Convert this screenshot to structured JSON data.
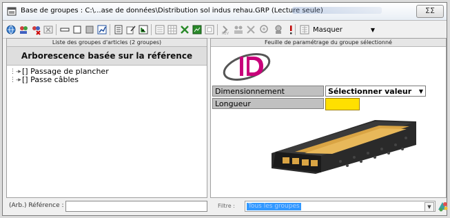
{
  "window": {
    "title": "Base de groupes : C:\\...ase de données\\Distribution sol indus rehau.GRP (Lecture seule)",
    "close_glyph": "ΣΣ"
  },
  "toolbar": {
    "icons": [
      "globe-icon",
      "group-add-icon",
      "group-remove-icon",
      "delete-icon",
      "minus-icon",
      "square-icon",
      "fill-icon",
      "chart-icon",
      "list-icon",
      "edit-icon",
      "tree-icon",
      "tree-edit-icon",
      "grid-icon",
      "export-icon",
      "image-icon",
      "refresh-icon",
      "rev-icon",
      "group-icon",
      "close-icon",
      "search-icon",
      "money-icon",
      "alert-icon",
      "calculator-icon"
    ],
    "masquer_label": "Masquer"
  },
  "left_panel": {
    "header": "Liste des groupes d'articles (2 groupes)",
    "tree_header": "Arborescence basée sur la référence",
    "items": [
      {
        "label": "[] Passage de plancher"
      },
      {
        "label": "[] Passe câbles"
      }
    ],
    "bottom_label": "(Arb.) Référence :",
    "bottom_value": ""
  },
  "right_panel": {
    "header": "Feuille de paramétrage du groupe sélectionné",
    "params": [
      {
        "label": "Dimensionnement",
        "value": "Sélectionner valeur"
      },
      {
        "label": "Longueur",
        "value": ""
      }
    ],
    "filter_label": "Filtre :",
    "filter_value": "Tous les groupes"
  },
  "colors": {
    "input_yellow": "#ffe000",
    "selection_blue": "#3399ff",
    "label_gray": "#c0c0c0"
  }
}
